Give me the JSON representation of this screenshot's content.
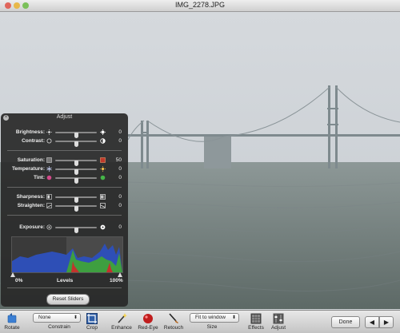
{
  "window": {
    "title": "IMG_2278.JPG"
  },
  "adjust_panel": {
    "title": "Adjust",
    "close_icon": "close-icon",
    "rows": [
      {
        "label": "Brightness:",
        "value": "0",
        "level": 0.5,
        "left_icon": "sun-small-icon",
        "right_icon": "sun-large-icon"
      },
      {
        "label": "Contrast:",
        "value": "0",
        "level": 0.5,
        "left_icon": "contrast-low-icon",
        "right_icon": "contrast-high-icon"
      },
      {
        "label": "Saturation:",
        "value": "50",
        "level": 0.5,
        "left_icon": "saturation-low-icon",
        "right_icon": "saturation-high-icon"
      },
      {
        "label": "Temperature:",
        "value": "0",
        "level": 0.5,
        "left_icon": "cool-icon",
        "right_icon": "warm-icon"
      },
      {
        "label": "Tint:",
        "value": "0",
        "level": 0.5,
        "left_icon": "tint-red-icon",
        "right_icon": "tint-green-icon"
      },
      {
        "label": "Sharpness:",
        "value": "0",
        "level": 0.5,
        "left_icon": "soft-icon",
        "right_icon": "sharp-icon"
      },
      {
        "label": "Straighten:",
        "value": "0",
        "level": 0.5,
        "left_icon": "tilt-left-icon",
        "right_icon": "tilt-right-icon"
      },
      {
        "label": "Exposure:",
        "value": "0",
        "level": 0.5,
        "left_icon": "aperture-small-icon",
        "right_icon": "aperture-large-icon"
      }
    ],
    "levels": {
      "min_label": "0%",
      "center_label": "Levels",
      "max_label": "100%"
    },
    "reset_button": "Reset Sliders"
  },
  "toolbar": {
    "rotate": "Rotate",
    "constrain_value": "None",
    "constrain_label": "Constrain",
    "crop": "Crop",
    "enhance": "Enhance",
    "redeye": "Red-Eye",
    "retouch": "Retouch",
    "size_value": "Fit to window",
    "size_label": "Size",
    "effects": "Effects",
    "adjust": "Adjust",
    "done": "Done",
    "prev_icon": "arrow-left-icon",
    "next_icon": "arrow-right-icon"
  },
  "colors": {
    "panel_bg": "#282828",
    "histogram_green": "#3fa33a",
    "histogram_blue": "#2e5fcf",
    "histogram_red": "#c3342c"
  }
}
